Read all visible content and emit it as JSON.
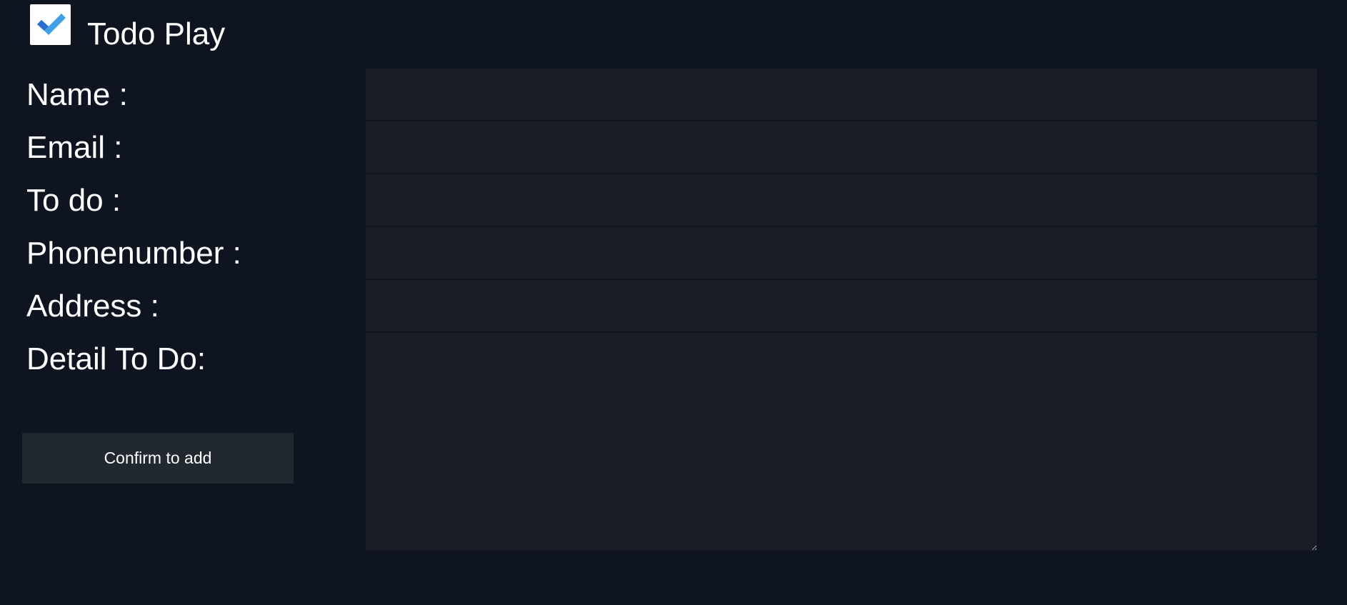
{
  "app": {
    "title": "Todo Play",
    "logo_icon": "check-icon",
    "colors": {
      "background": "#0e1521",
      "input_background": "#1a1d25",
      "button_background": "#212830",
      "logo_check_light": "#3fa1ea",
      "logo_check_dark": "#1f5bbf"
    }
  },
  "form": {
    "fields": [
      {
        "label": "Name :",
        "value": "",
        "placeholder": ""
      },
      {
        "label": "Email :",
        "value": "",
        "placeholder": ""
      },
      {
        "label": "To do :",
        "value": "",
        "placeholder": ""
      },
      {
        "label": "Phonenumber :",
        "value": "",
        "placeholder": ""
      },
      {
        "label": "Address :",
        "value": "",
        "placeholder": ""
      }
    ],
    "detail": {
      "label": "Detail To Do:",
      "value": "",
      "placeholder": ""
    },
    "confirm_label": "Confirm to add"
  }
}
